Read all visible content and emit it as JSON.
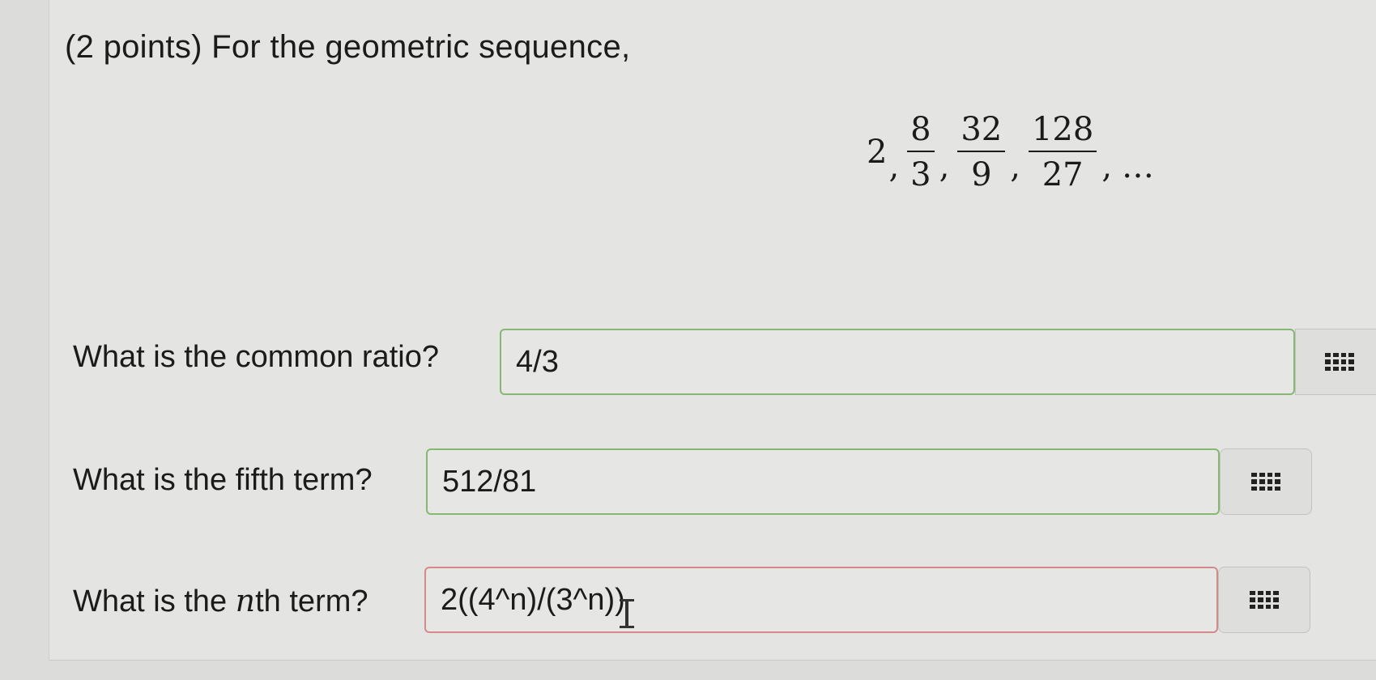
{
  "question": {
    "prompt": "(2 points) For the geometric sequence,",
    "sequence": {
      "first": "2",
      "fractions": [
        {
          "num": "8",
          "den": "3"
        },
        {
          "num": "32",
          "den": "9"
        },
        {
          "num": "128",
          "den": "27"
        }
      ],
      "comma": ",",
      "ellipsis": "…"
    }
  },
  "parts": [
    {
      "label": "What is the common ratio?",
      "answer": "4/3",
      "status": "correct"
    },
    {
      "label": "What is the fifth term?",
      "answer": "512/81",
      "status": "correct"
    },
    {
      "label_pre": "What is the ",
      "label_var": "n",
      "label_post": "th term?",
      "answer": "2((4^n)/(3^n))",
      "status": "incorrect"
    }
  ],
  "icons": {
    "matrix": "matrix-grid-icon",
    "cursor": "text-cursor-icon"
  },
  "colors": {
    "correct_border": "#86b873",
    "incorrect_border": "#d58a8a"
  }
}
